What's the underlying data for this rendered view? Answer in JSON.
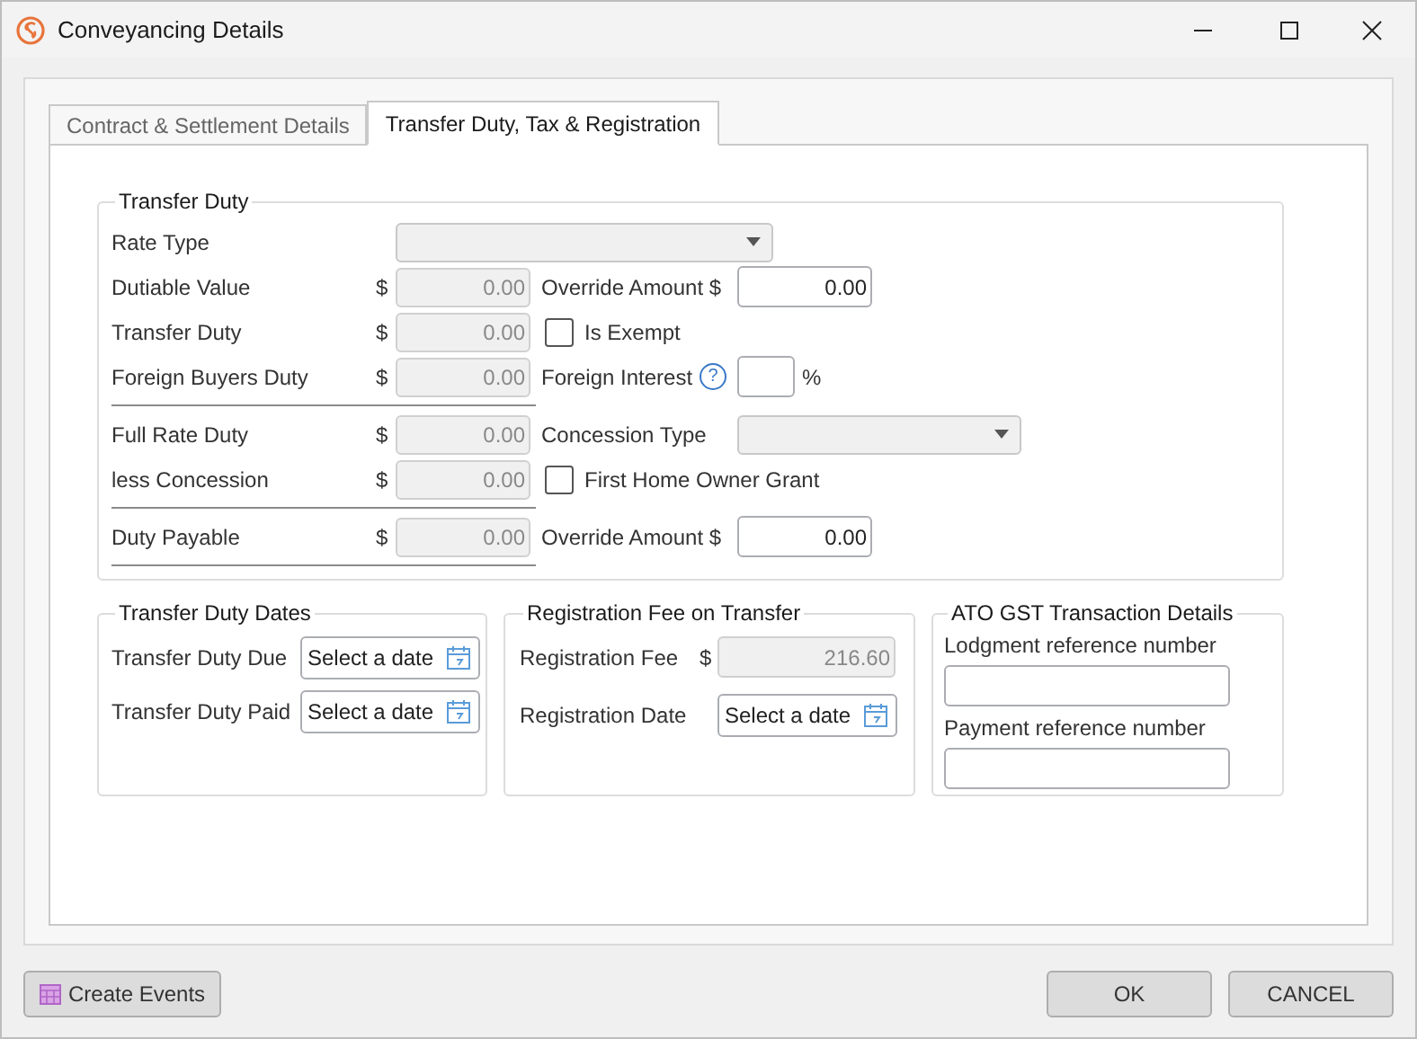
{
  "window": {
    "title": "Conveyancing Details"
  },
  "tabs": [
    {
      "label": "Contract & Settlement Details",
      "selected": false
    },
    {
      "label": "Transfer Duty, Tax & Registration",
      "selected": true
    }
  ],
  "transfer_duty": {
    "title": "Transfer Duty",
    "rate_type": {
      "label": "Rate Type",
      "disabled": true
    },
    "rows": [
      {
        "label": "Dutiable Value",
        "currency": "$",
        "value": "0.00",
        "divider_below": false,
        "right": {
          "kind": "amount",
          "label": "Override Amount $",
          "value": "0.00"
        }
      },
      {
        "label": "Transfer Duty",
        "currency": "$",
        "value": "0.00",
        "divider_below": false,
        "right": {
          "kind": "checkbox",
          "label": "Is Exempt",
          "checked": false
        }
      },
      {
        "label": "Foreign Buyers Duty",
        "currency": "$",
        "value": "0.00",
        "divider_below": true,
        "right": {
          "kind": "percent",
          "label": "Foreign Interest",
          "help": "?",
          "suffix": "%"
        }
      },
      {
        "label": "Full Rate Duty",
        "currency": "$",
        "value": "0.00",
        "divider_below": false,
        "right": {
          "kind": "select",
          "label": "Concession Type",
          "disabled": true
        }
      },
      {
        "label": "less Concession",
        "currency": "$",
        "value": "0.00",
        "divider_below": true,
        "right": {
          "kind": "checkbox",
          "label": "First Home Owner Grant",
          "checked": false
        }
      },
      {
        "label": "Duty Payable",
        "currency": "$",
        "value": "0.00",
        "divider_below": true,
        "right": {
          "kind": "amount",
          "label": "Override Amount $",
          "value": "0.00"
        }
      }
    ]
  },
  "duty_dates": {
    "title": "Transfer Duty Dates",
    "rows": [
      {
        "label": "Transfer Duty Due",
        "placeholder": "Select a date"
      },
      {
        "label": "Transfer Duty Paid",
        "placeholder": "Select a date"
      }
    ]
  },
  "registration": {
    "title": "Registration Fee on Transfer",
    "fee": {
      "label": "Registration Fee",
      "currency": "$",
      "value": "216.60"
    },
    "date": {
      "label": "Registration Date",
      "placeholder": "Select a date"
    }
  },
  "ato": {
    "title": "ATO GST Transaction Details",
    "fields": [
      {
        "label": "Lodgment reference number"
      },
      {
        "label": "Payment reference number"
      }
    ]
  },
  "footer": {
    "create_events": "Create Events",
    "buttons": [
      "OK",
      "CANCEL"
    ]
  }
}
